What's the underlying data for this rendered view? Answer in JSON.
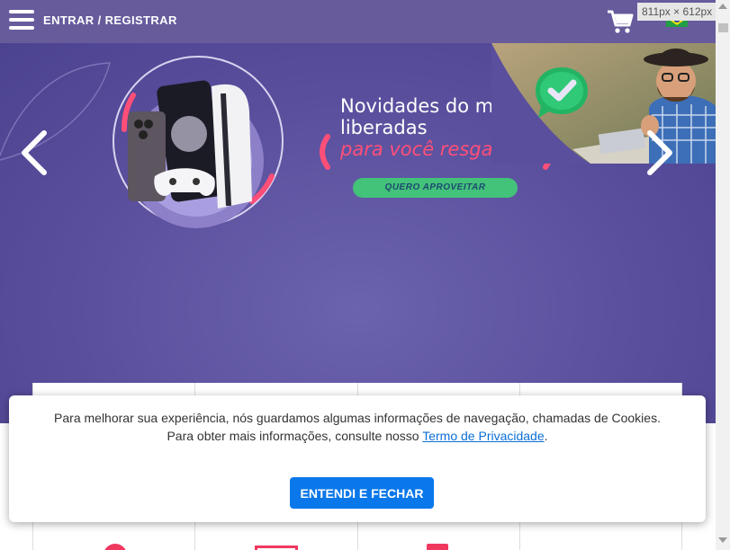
{
  "header": {
    "login_label": "ENTRAR / REGISTRAR",
    "cart_icon": "cart-icon",
    "flag_icon": "brazil-flag-icon",
    "size_indicator": "811px × 612px"
  },
  "hero": {
    "headline": "Novidades do mês liberadas",
    "headline_line1": "Novidades do mês",
    "headline_line2": "liberadas",
    "subheadline": "para você resgatar!",
    "cta_label": "QUERO APROVEITAR",
    "prev_icon": "chevron-left-icon",
    "next_icon": "chevron-right-icon"
  },
  "cookie_banner": {
    "text_line1": "Para melhorar sua experiência, nós guardamos algumas informações de navegação, chamadas de Cookies.",
    "text_line2_prefix": "Para obter mais informações, consulte nosso ",
    "privacy_link": "Termo de Privacidade",
    "text_line2_suffix": ".",
    "button_label": "ENTENDI E FECHAR"
  },
  "colors": {
    "header_bg": "#675b9c",
    "hero_bg": "#5a4f9d",
    "accent_pink": "#ff4f78",
    "cta_green": "#43c27a",
    "button_blue": "#0a78ea",
    "link_blue": "#0a6fd6"
  }
}
